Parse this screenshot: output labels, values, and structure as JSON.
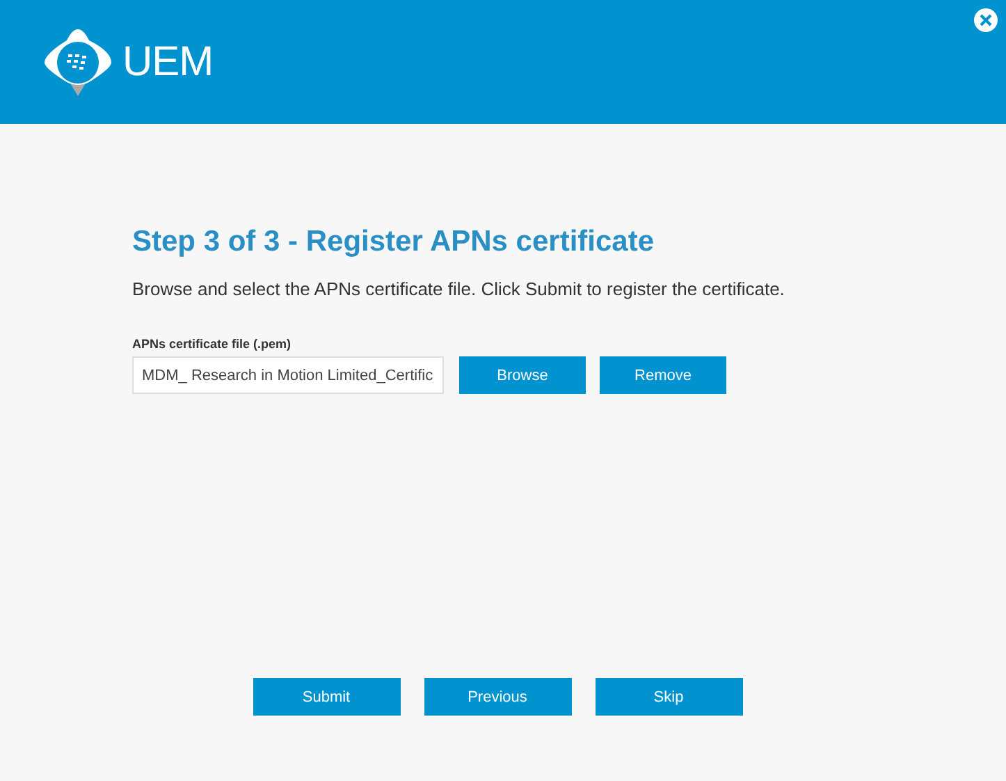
{
  "header": {
    "logo_text": "UEM"
  },
  "title": "Step 3 of 3 - Register APNs certificate",
  "description": "Browse and select the APNs certificate file. Click Submit to register the certificate.",
  "file_field": {
    "label": "APNs certificate file (.pem)",
    "value": "MDM_ Research in Motion Limited_Certific"
  },
  "field_buttons": [
    "Browse",
    "Remove"
  ],
  "footer_buttons": [
    "Submit",
    "Previous",
    "Skip"
  ]
}
